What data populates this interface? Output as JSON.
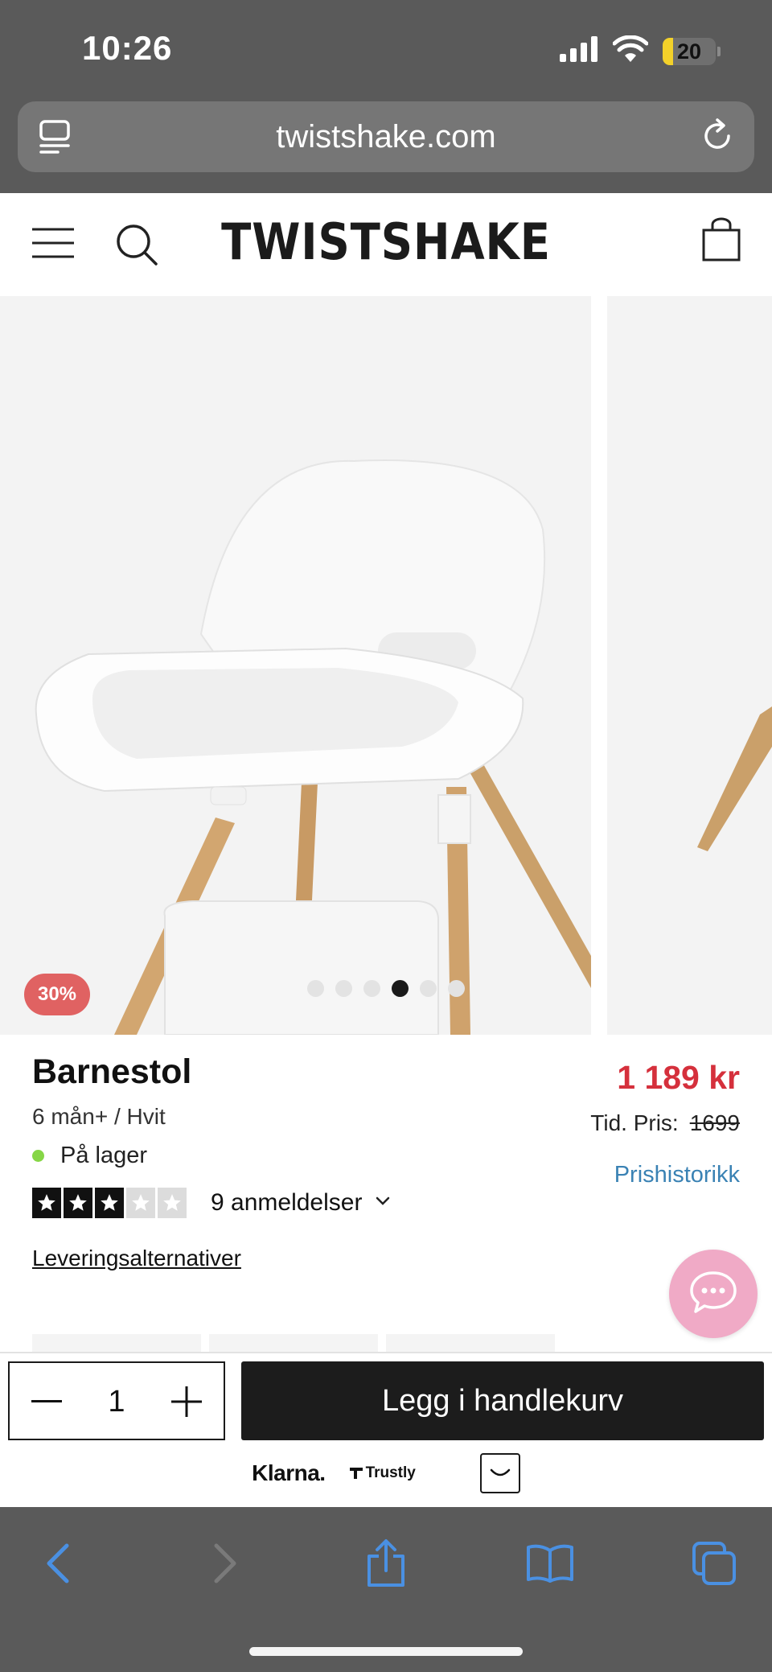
{
  "status_bar": {
    "time": "10:26",
    "battery": "20",
    "battery_level_percent": 20,
    "icons": [
      "cellular-signal-icon",
      "wifi-icon",
      "battery-icon"
    ]
  },
  "browser": {
    "url": "twistshake.com",
    "left_icon": "page-menu-icon",
    "right_icon": "reload-icon",
    "toolbar_icons": [
      "back-icon",
      "forward-icon",
      "share-icon",
      "bookmarks-icon",
      "tabs-icon"
    ]
  },
  "header": {
    "brand": "TWISTSHAKE",
    "icons": [
      "menu-icon",
      "search-icon",
      "shopping-bag-icon"
    ]
  },
  "gallery": {
    "discount_badge": "30%",
    "slide_count": 6,
    "active_slide": 4
  },
  "product": {
    "name": "Barnestol",
    "variant": "6 mån+ / Hvit",
    "stock_status": "På lager",
    "stock_color": "#86d646",
    "rating_stars": 3,
    "rating_max": 5,
    "reviews_label": "9 anmeldelser",
    "delivery_link": "Leveringsalternativer",
    "price_current": "1 189 kr",
    "price_previous_label": "Tid. Pris:",
    "price_previous": "1699",
    "price_history_link": "Prishistorikk"
  },
  "buy_bar": {
    "quantity": "1",
    "add_to_cart_label": "Legg i handlekurv",
    "payment_methods": [
      "Klarna.",
      "Trustly"
    ]
  },
  "colors": {
    "price_red": "#d5303c",
    "badge_red": "#e06262",
    "link_blue": "#3a82b4",
    "chat_pink": "#f0aac6",
    "browser_chrome": "#5a5a5a",
    "toolbar_blue": "#4a90e2"
  }
}
